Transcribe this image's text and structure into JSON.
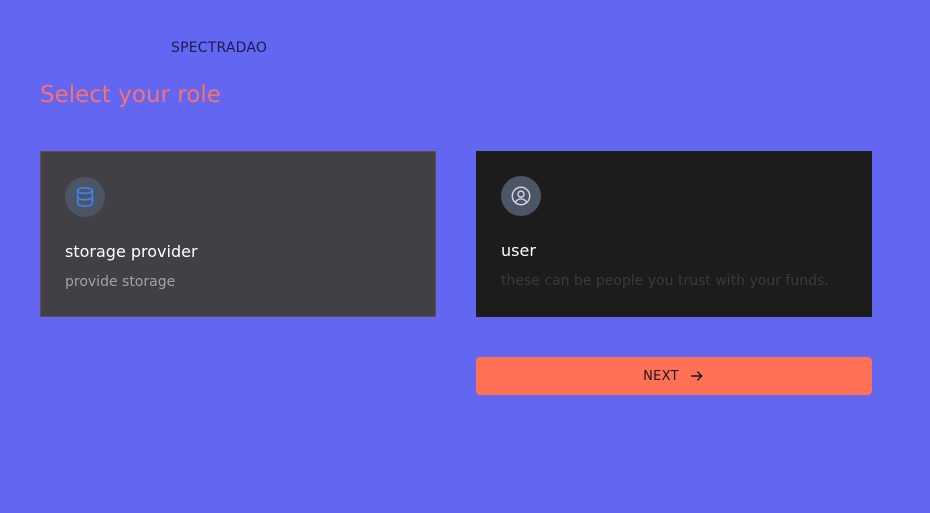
{
  "brand": {
    "name": "SPECTRADAO"
  },
  "page": {
    "title": "Select your role"
  },
  "roles": [
    {
      "title": "storage provider",
      "description": "provide storage",
      "icon": "database-icon",
      "selected": true
    },
    {
      "title": "user",
      "description": "these can be people you trust with your funds.",
      "icon": "user-circle-icon",
      "selected": false
    }
  ],
  "actions": {
    "next_label": "NEXT",
    "next_icon": "arrow-right-icon"
  },
  "colors": {
    "background": "#6366f1",
    "title": "#f87171",
    "selected_card": "#404045",
    "card": "#1c1c1c",
    "next_button": "#ff7055",
    "icon_accent": "#3b82f6"
  }
}
